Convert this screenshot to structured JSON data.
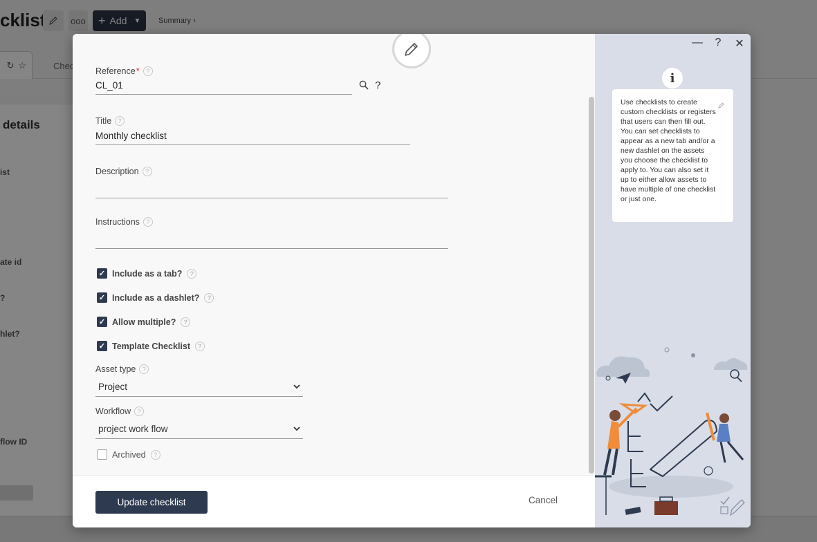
{
  "background": {
    "title": "cklist",
    "add_label": "Add",
    "summary_link": "Summary ›",
    "tab_label": "Chec",
    "details_heading": "details",
    "labels": [
      "ist",
      "ate id",
      "?",
      "hlet?",
      "flow ID"
    ]
  },
  "modal": {
    "fields": {
      "reference": {
        "label": "Reference",
        "required_mark": "*",
        "value": "CL_01"
      },
      "title": {
        "label": "Title",
        "value": "Monthly checklist"
      },
      "description": {
        "label": "Description",
        "value": ""
      },
      "instructions": {
        "label": "Instructions",
        "value": ""
      }
    },
    "checkboxes": [
      {
        "label": "Include as a tab?",
        "checked": true
      },
      {
        "label": "Include as a dashlet?",
        "checked": true
      },
      {
        "label": "Allow multiple?",
        "checked": true
      },
      {
        "label": "Template Checklist",
        "checked": true
      },
      {
        "label": "Archived",
        "checked": false
      }
    ],
    "asset_type": {
      "label": "Asset type",
      "value": "Project"
    },
    "workflow": {
      "label": "Workflow",
      "value": "project work flow"
    },
    "primary_button": "Update checklist",
    "cancel": "Cancel",
    "lookup_question": "?"
  },
  "help_panel": {
    "text": "Use checklists to create custom checklists or registers that users can then fill out. You can set checklists to appear as a new tab and/or a new dashlet on the assets you choose the checklist to apply to. You can also set it up to either allow assets to have multiple of one checklist or just one.",
    "info_glyph": "i",
    "controls": {
      "minimize": "—",
      "help": "?",
      "close": "✕"
    }
  },
  "colors": {
    "primary": "#2e3a4f",
    "required": "#d9262f",
    "panel": "#d8dde8"
  },
  "icons": [
    "pencil-icon",
    "search-icon",
    "help-icon",
    "info-icon",
    "chevron-down-icon",
    "close-icon",
    "minimize-icon"
  ]
}
